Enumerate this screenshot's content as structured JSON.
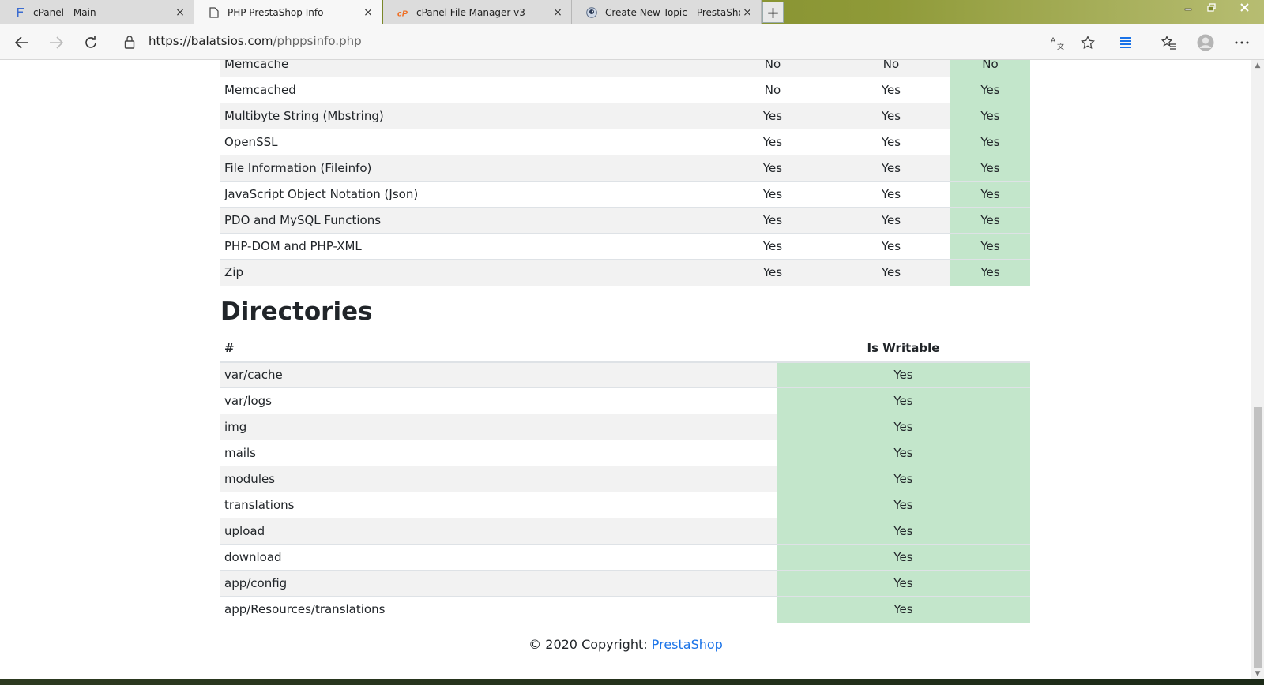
{
  "browser": {
    "tabs": [
      {
        "label": "cPanel - Main",
        "icon": "cpanel-f-icon"
      },
      {
        "label": "PHP PrestaShop Info",
        "icon": "page-icon"
      },
      {
        "label": "cPanel File Manager v3",
        "icon": "cpanel-cp-icon"
      },
      {
        "label": "Create New Topic - PrestaShop F",
        "icon": "prestashop-icon"
      }
    ],
    "close_glyph": "×",
    "new_tab_glyph": "+",
    "url_host": "https://balatsios.com",
    "url_path": "/phppsinfo.php"
  },
  "extensions": {
    "rows": [
      {
        "name": "Memcache",
        "a": "No",
        "b": "No",
        "c": "No"
      },
      {
        "name": "Memcached",
        "a": "No",
        "b": "Yes",
        "c": "Yes"
      },
      {
        "name": "Multibyte String (Mbstring)",
        "a": "Yes",
        "b": "Yes",
        "c": "Yes"
      },
      {
        "name": "OpenSSL",
        "a": "Yes",
        "b": "Yes",
        "c": "Yes"
      },
      {
        "name": "File Information (Fileinfo)",
        "a": "Yes",
        "b": "Yes",
        "c": "Yes"
      },
      {
        "name": "JavaScript Object Notation (Json)",
        "a": "Yes",
        "b": "Yes",
        "c": "Yes"
      },
      {
        "name": "PDO and MySQL Functions",
        "a": "Yes",
        "b": "Yes",
        "c": "Yes"
      },
      {
        "name": "PHP-DOM and PHP-XML",
        "a": "Yes",
        "b": "Yes",
        "c": "Yes"
      },
      {
        "name": "Zip",
        "a": "Yes",
        "b": "Yes",
        "c": "Yes"
      }
    ]
  },
  "directories": {
    "title": "Directories",
    "col_hash": "#",
    "col_writable": "Is Writable",
    "rows": [
      {
        "path": "var/cache",
        "writable": "Yes"
      },
      {
        "path": "var/logs",
        "writable": "Yes"
      },
      {
        "path": "img",
        "writable": "Yes"
      },
      {
        "path": "mails",
        "writable": "Yes"
      },
      {
        "path": "modules",
        "writable": "Yes"
      },
      {
        "path": "translations",
        "writable": "Yes"
      },
      {
        "path": "upload",
        "writable": "Yes"
      },
      {
        "path": "download",
        "writable": "Yes"
      },
      {
        "path": "app/config",
        "writable": "Yes"
      },
      {
        "path": "app/Resources/translations",
        "writable": "Yes"
      }
    ]
  },
  "footer": {
    "copyright": "© 2020 Copyright: ",
    "link": "PrestaShop"
  }
}
